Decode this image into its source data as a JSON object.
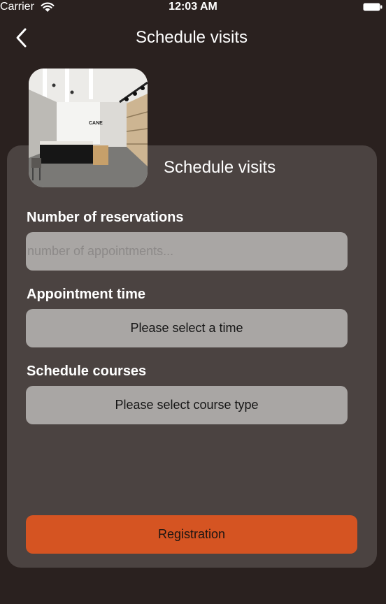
{
  "status_bar": {
    "carrier": "Carrier",
    "time": "12:03 AM"
  },
  "nav": {
    "title": "Schedule visits",
    "back_icon": "chevron-left-icon"
  },
  "card": {
    "title": "Schedule visits",
    "image_alt": "store-interior-photo"
  },
  "form": {
    "reservations": {
      "label": "Number of reservations",
      "placeholder": "number of appointments...",
      "value": ""
    },
    "time": {
      "label": "Appointment time",
      "value": "Please select a time"
    },
    "courses": {
      "label": "Schedule courses",
      "value": "Please select course type"
    },
    "submit_label": "Registration"
  },
  "colors": {
    "background": "#2a211f",
    "card": "#4b4341",
    "field": "#a9a6a4",
    "accent": "#d55422"
  }
}
